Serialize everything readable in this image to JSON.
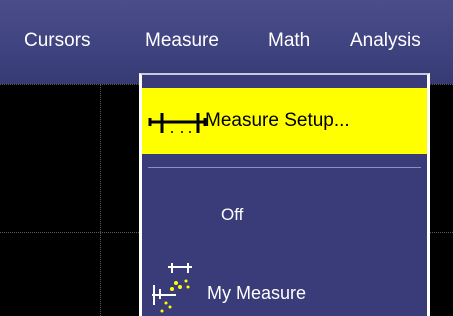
{
  "menubar": {
    "items": [
      {
        "label": "Cursors"
      },
      {
        "label": "Measure"
      },
      {
        "label": "Math"
      },
      {
        "label": "Analysis"
      }
    ]
  },
  "dropdown": {
    "items": [
      {
        "label": "Measure Setup...",
        "icon": "measure-setup-icon",
        "highlighted": true
      },
      {
        "label": "Off"
      },
      {
        "label": "My Measure",
        "icon": "my-measure-icon"
      }
    ]
  },
  "colors": {
    "menubar": "#3f437f",
    "menu_background": "#3a3c7a",
    "highlight": "#ffff00",
    "text": "#ffffff",
    "grid": "#000000"
  }
}
